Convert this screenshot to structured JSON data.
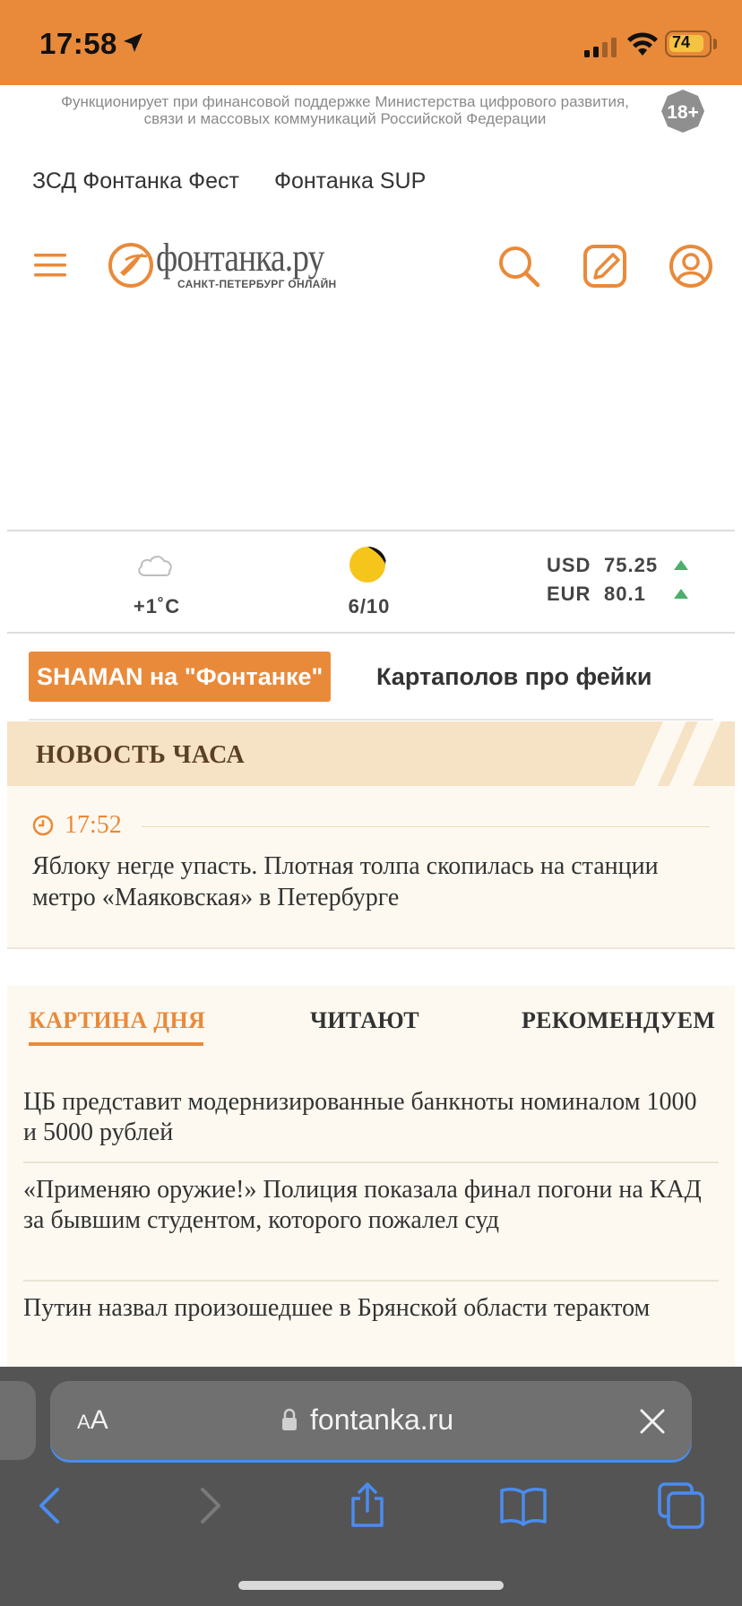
{
  "status_bar": {
    "time": "17:58",
    "battery": "74"
  },
  "sponsor": {
    "text": "Функционирует при финансовой поддержке Министерства цифрового развития, связи и массовых коммуникаций Российской Федерации",
    "age": "18+"
  },
  "top_links": [
    "ЗСД Фонтанка Фест",
    "Фонтанка SUP"
  ],
  "logo": {
    "name": "фонтанка.ру",
    "tagline": "САНКТ-ПЕТЕРБУРГ ОНЛАЙН"
  },
  "info": {
    "temperature": "+1˚C",
    "traffic": "6/10",
    "currencies": [
      {
        "name": "USD",
        "value": "75.25",
        "trend": "up"
      },
      {
        "name": "EUR",
        "value": "80.1",
        "trend": "up"
      }
    ]
  },
  "tags": [
    "SHAMAN на \"Фонтанке\"",
    "Картаполов про фейки"
  ],
  "news_hour": {
    "title": "НОВОСТЬ ЧАСА",
    "time": "17:52",
    "text": "Яблоку негде упасть. Плотная толпа скопилась на станции метро «Маяковская» в Петербурге"
  },
  "tabs": [
    {
      "label": "КАРТИНА ДНЯ",
      "active": true
    },
    {
      "label": "ЧИТАЮТ",
      "active": false
    },
    {
      "label": "РЕКОМЕНДУЕМ",
      "active": false
    }
  ],
  "articles": [
    "ЦБ представит модернизированные банкноты номиналом 1000 и 5000 рублей",
    "«Применяю оружие!» Полиция показала финал погони на КАД за бывшим студентом, которого пожалел суд",
    "Путин назвал произошедшее в Брянской области терактом"
  ],
  "browser": {
    "url": "fontanka.ru",
    "aa_small": "A",
    "aa_large": "A"
  },
  "colors": {
    "brand": "#e98a3a",
    "browser": "#545454"
  }
}
